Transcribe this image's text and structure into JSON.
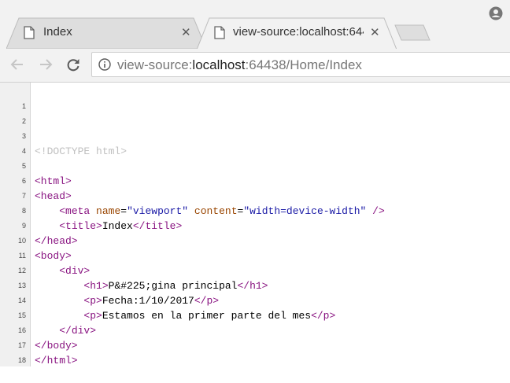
{
  "tabs": [
    {
      "title": "Index",
      "active": false
    },
    {
      "title": "view-source:localhost:64438/Home/Index",
      "active": true
    }
  ],
  "toolbar": {
    "url_prefix": "view-source:",
    "url_host": "localhost",
    "url_rest": ":64438/Home/Index"
  },
  "icons": {
    "back": "arrow-left-icon",
    "forward": "arrow-right-icon",
    "reload": "reload-icon",
    "info": "info-icon",
    "page": "page-icon",
    "close": "close-icon",
    "profile": "account-icon"
  },
  "colors": {
    "tag": "#881280",
    "attribute": "#994500",
    "value": "#1a1aa6",
    "doctype": "#c0c0c0"
  },
  "source": {
    "line_numbers": [
      "1",
      "2",
      "3",
      "4",
      "5",
      "6",
      "7",
      "8",
      "9",
      "10",
      "11",
      "12",
      "13",
      "14",
      "15",
      "16",
      "17",
      "18"
    ],
    "doctype": "<!DOCTYPE html>",
    "tag_html_open": "<html>",
    "tag_head_open": "<head>",
    "tag_meta_open": "<meta",
    "attr_name": "name",
    "val_viewport": "\"viewport\"",
    "attr_content": "content",
    "val_width": "\"width=device-width\"",
    "tag_selfclose": "/>",
    "tag_title_open": "<title>",
    "text_title": "Index",
    "tag_title_close": "</title>",
    "tag_head_close": "</head>",
    "tag_body_open": "<body>",
    "tag_div_open": "<div>",
    "tag_h1_open": "<h1>",
    "text_h1": "P&#225;gina principal",
    "tag_h1_close": "</h1>",
    "tag_p_open": "<p>",
    "text_p1": "Fecha:1/10/2017",
    "tag_p_close": "</p>",
    "text_p2": "Estamos en la primer parte del mes",
    "tag_div_close": "</div>",
    "tag_body_close": "</body>",
    "tag_html_close": "</html>"
  }
}
